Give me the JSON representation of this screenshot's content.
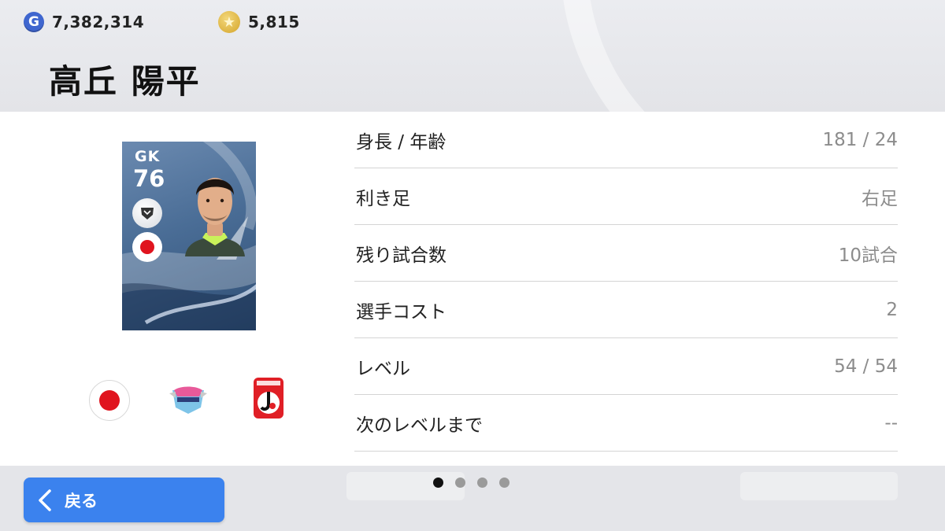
{
  "currency": {
    "gp": {
      "icon": "gp-coin-icon",
      "letter": "G",
      "value": "7,382,314"
    },
    "coins": {
      "icon": "star-coin-icon",
      "value": "5,815"
    }
  },
  "player": {
    "name": "高丘 陽平",
    "card": {
      "position": "GK",
      "rating": "76"
    }
  },
  "info": [
    {
      "label": "身長 / 年齢",
      "value": "181 / 24"
    },
    {
      "label": "利き足",
      "value": "右足"
    },
    {
      "label": "残り試合数",
      "value": "10試合"
    },
    {
      "label": "選手コスト",
      "value": "2"
    },
    {
      "label": "レベル",
      "value": "54 / 54"
    },
    {
      "label": "次のレベルまで",
      "value": "--"
    }
  ],
  "pagination": {
    "pages": 4,
    "current": 1
  },
  "footer": {
    "back_label": "戻る"
  },
  "colors": {
    "accent": "#3b82ee",
    "flag_red": "#e0141e",
    "card_blue": "#4a6d96"
  }
}
